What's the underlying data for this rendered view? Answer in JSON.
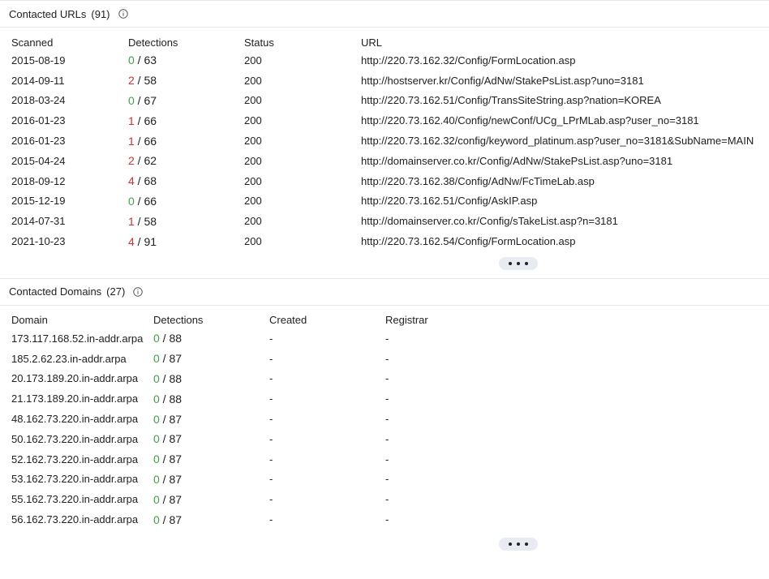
{
  "urls_section": {
    "title": "Contacted URLs",
    "count": "(91)",
    "columns": [
      "Scanned",
      "Detections",
      "Status",
      "URL"
    ],
    "rows": [
      {
        "scanned": "2015-08-19",
        "det_pos": "0",
        "det_total": " / 63",
        "status": "200",
        "url": "http://220.73.162.32/Config/FormLocation.asp"
      },
      {
        "scanned": "2014-09-11",
        "det_pos": "2",
        "det_total": " / 58",
        "status": "200",
        "url": "http://hostserver.kr/Config/AdNw/StakePsList.asp?uno=3181"
      },
      {
        "scanned": "2018-03-24",
        "det_pos": "0",
        "det_total": " / 67",
        "status": "200",
        "url": "http://220.73.162.51/Config/TransSiteString.asp?nation=KOREA"
      },
      {
        "scanned": "2016-01-23",
        "det_pos": "1",
        "det_total": " / 66",
        "status": "200",
        "url": "http://220.73.162.40/Config/newConf/UCg_LPrMLab.asp?user_no=3181"
      },
      {
        "scanned": "2016-01-23",
        "det_pos": "1",
        "det_total": " / 66",
        "status": "200",
        "url": "http://220.73.162.32/config/keyword_platinum.asp?user_no=3181&SubName=MAIN"
      },
      {
        "scanned": "2015-04-24",
        "det_pos": "2",
        "det_total": " / 62",
        "status": "200",
        "url": "http://domainserver.co.kr/Config/AdNw/StakePsList.asp?uno=3181"
      },
      {
        "scanned": "2018-09-12",
        "det_pos": "4",
        "det_total": " / 68",
        "status": "200",
        "url": "http://220.73.162.38/Config/AdNw/FcTimeLab.asp"
      },
      {
        "scanned": "2015-12-19",
        "det_pos": "0",
        "det_total": " / 66",
        "status": "200",
        "url": "http://220.73.162.51/Config/AskIP.asp"
      },
      {
        "scanned": "2014-07-31",
        "det_pos": "1",
        "det_total": " / 58",
        "status": "200",
        "url": "http://domainserver.co.kr/Config/sTakeList.asp?n=3181"
      },
      {
        "scanned": "2021-10-23",
        "det_pos": "4",
        "det_total": " / 91",
        "status": "200",
        "url": "http://220.73.162.54/Config/FormLocation.asp"
      }
    ]
  },
  "domains_section": {
    "title": "Contacted Domains",
    "count": "(27)",
    "columns": [
      "Domain",
      "Detections",
      "Created",
      "Registrar"
    ],
    "rows": [
      {
        "domain": "173.117.168.52.in-addr.arpa",
        "det_pos": "0",
        "det_total": " / 88",
        "created": "-",
        "registrar": "-"
      },
      {
        "domain": "185.2.62.23.in-addr.arpa",
        "det_pos": "0",
        "det_total": " / 87",
        "created": "-",
        "registrar": "-"
      },
      {
        "domain": "20.173.189.20.in-addr.arpa",
        "det_pos": "0",
        "det_total": " / 88",
        "created": "-",
        "registrar": "-"
      },
      {
        "domain": "21.173.189.20.in-addr.arpa",
        "det_pos": "0",
        "det_total": " / 88",
        "created": "-",
        "registrar": "-"
      },
      {
        "domain": "48.162.73.220.in-addr.arpa",
        "det_pos": "0",
        "det_total": " / 87",
        "created": "-",
        "registrar": "-"
      },
      {
        "domain": "50.162.73.220.in-addr.arpa",
        "det_pos": "0",
        "det_total": " / 87",
        "created": "-",
        "registrar": "-"
      },
      {
        "domain": "52.162.73.220.in-addr.arpa",
        "det_pos": "0",
        "det_total": " / 87",
        "created": "-",
        "registrar": "-"
      },
      {
        "domain": "53.162.73.220.in-addr.arpa",
        "det_pos": "0",
        "det_total": " / 87",
        "created": "-",
        "registrar": "-"
      },
      {
        "domain": "55.162.73.220.in-addr.arpa",
        "det_pos": "0",
        "det_total": " / 87",
        "created": "-",
        "registrar": "-"
      },
      {
        "domain": "56.162.73.220.in-addr.arpa",
        "det_pos": "0",
        "det_total": " / 87",
        "created": "-",
        "registrar": "-"
      }
    ]
  },
  "icons": {
    "info": "info-icon",
    "more": "more-dots-icon"
  },
  "colors": {
    "malicious": "#d32f2f",
    "clean": "#43a047",
    "border": "#e6e8ee",
    "more_bg": "#e8ebf2"
  }
}
